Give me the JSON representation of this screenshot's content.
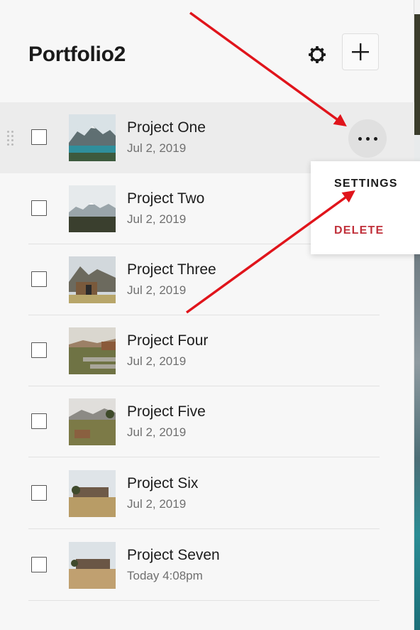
{
  "header": {
    "title": "Portfolio2",
    "settings_icon": "gear-icon",
    "add_icon": "plus-icon"
  },
  "projects": [
    {
      "name": "Project One",
      "date": "Jul 2, 2019",
      "thumb": "lake-mountains"
    },
    {
      "name": "Project Two",
      "date": "Jul 2, 2019",
      "thumb": "snowy-mountains"
    },
    {
      "name": "Project Three",
      "date": "Jul 2, 2019",
      "thumb": "cabin-mountain"
    },
    {
      "name": "Project Four",
      "date": "Jul 2, 2019",
      "thumb": "grassy-steps"
    },
    {
      "name": "Project Five",
      "date": "Jul 2, 2019",
      "thumb": "hillside-cabin"
    },
    {
      "name": "Project Six",
      "date": "Jul 2, 2019",
      "thumb": "field-house"
    },
    {
      "name": "Project Seven",
      "date": "Today 4:08pm",
      "thumb": "field-house-2"
    }
  ],
  "row_actions": {
    "more_icon": "more-horizontal-icon"
  },
  "context_menu": {
    "settings_label": "SETTINGS",
    "delete_label": "DELETE"
  },
  "colors": {
    "delete": "#c0303a",
    "active_row": "#ececec",
    "annotation_arrow": "#e0141b"
  }
}
